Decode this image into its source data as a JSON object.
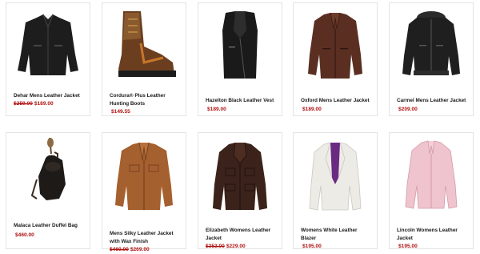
{
  "products": [
    {
      "title": "Dehar Mens Leather Jacket",
      "old_price": "$259.00",
      "price": "$189.00",
      "icon": "black-leather-jacket"
    },
    {
      "title": "Cordura® Plus Leather Hunting Boots",
      "old_price": "",
      "price": "$149.55",
      "icon": "brown-leather-boots"
    },
    {
      "title": "Hazelton Black Leather Vest",
      "old_price": "",
      "price": "$189.00",
      "icon": "black-leather-vest"
    },
    {
      "title": "Oxford Mens Leather Jacket",
      "old_price": "",
      "price": "$189.00",
      "icon": "brown-leather-jacket"
    },
    {
      "title": "Carmel Mens Leather Jacket",
      "old_price": "",
      "price": "$209.00",
      "icon": "black-bomber-jacket"
    },
    {
      "title": "Malaca Leather Duffel Bag",
      "old_price": "",
      "price": "$460.00",
      "icon": "leather-duffel-bag"
    },
    {
      "title": "Mens Silky Leather Jacket with Wax Finish",
      "old_price": "$460.00",
      "price": "$269.00",
      "icon": "tan-leather-jacket"
    },
    {
      "title": "Elizabeth Womens Leather Jacket",
      "old_price": "$353.00",
      "price": "$229.00",
      "icon": "dark-brown-womens-jacket"
    },
    {
      "title": "Womens White Leather Blazer",
      "old_price": "",
      "price": "$195.00",
      "icon": "white-leather-blazer"
    },
    {
      "title": "Lincoln Womens Leather Jacket",
      "old_price": "",
      "price": "$195.00",
      "icon": "pink-leather-jacket"
    }
  ]
}
